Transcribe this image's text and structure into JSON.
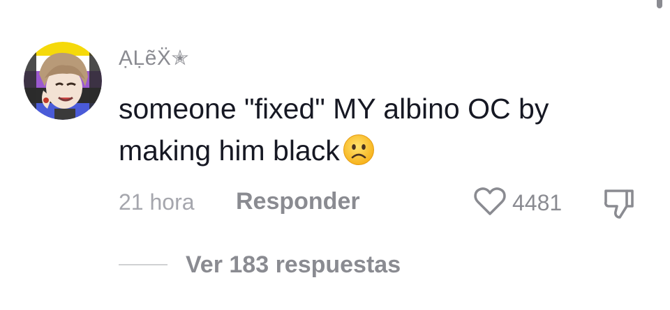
{
  "comment": {
    "username": "ẠḶẽẌ✭",
    "text": "someone \"fixed\" MY albino OC by making him black",
    "emoji": "frowning-face-emoji",
    "timestamp": "21 hora",
    "reply_label": "Responder",
    "like_count": "4481",
    "like_icon": "heart-outline-icon",
    "dislike_icon": "thumbs-down-icon"
  },
  "replies": {
    "label": "Ver 183 respuestas"
  },
  "colors": {
    "text_primary": "#161823",
    "text_secondary": "#8a8b91",
    "text_tertiary": "#a5a6ad",
    "emoji_yellow": "#fcc21b"
  }
}
